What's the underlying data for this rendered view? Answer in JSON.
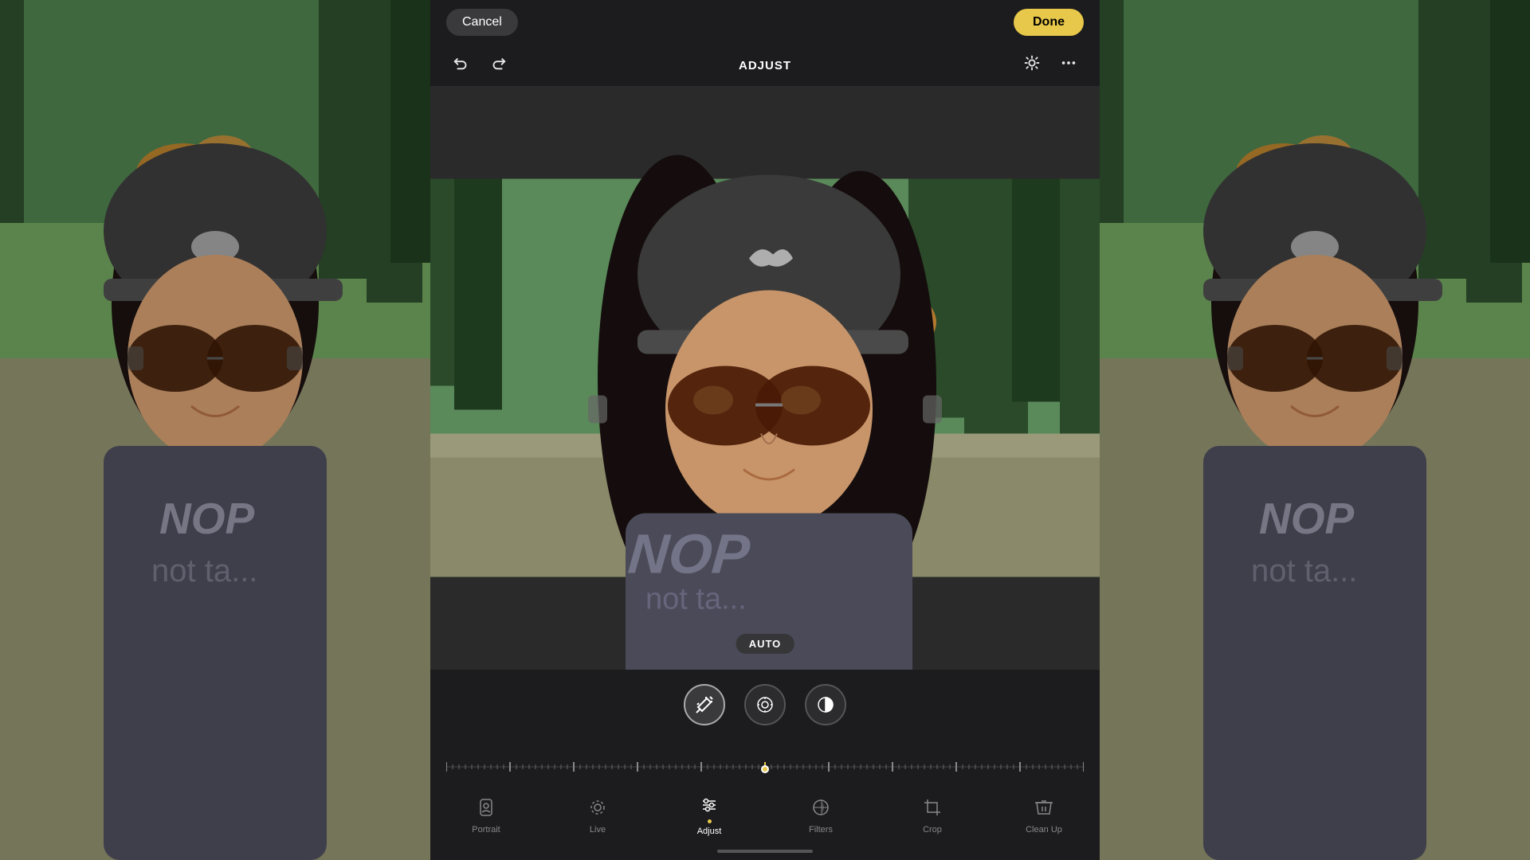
{
  "header": {
    "cancel_label": "Cancel",
    "done_label": "Done",
    "title": "ADJUST"
  },
  "toolbar": {
    "undo_icon": "↩",
    "redo_icon": "↪",
    "auto_enhance_icon": "✦",
    "more_icon": "⋯"
  },
  "photo": {
    "auto_badge": "AUTO"
  },
  "adjust_controls": {
    "magic_icon": "✦",
    "exposure_icon": "◎",
    "yin_yang_icon": "☯"
  },
  "tabs": [
    {
      "id": "portrait",
      "label": "Portrait",
      "icon": "ƒ",
      "active": false
    },
    {
      "id": "live",
      "label": "Live",
      "icon": "◎",
      "active": false
    },
    {
      "id": "adjust",
      "label": "Adjust",
      "icon": "✦",
      "active": true
    },
    {
      "id": "filters",
      "label": "Filters",
      "icon": "◈",
      "active": false
    },
    {
      "id": "crop",
      "label": "Crop",
      "icon": "⊡",
      "active": false
    },
    {
      "id": "cleanup",
      "label": "Clean Up",
      "icon": "◇",
      "active": false
    }
  ],
  "colors": {
    "accent": "#e8c84a",
    "active_tab": "#ffffff",
    "inactive_tab": "#888888",
    "background": "#1c1c1e",
    "btn_cancel_bg": "#3a3a3c"
  }
}
